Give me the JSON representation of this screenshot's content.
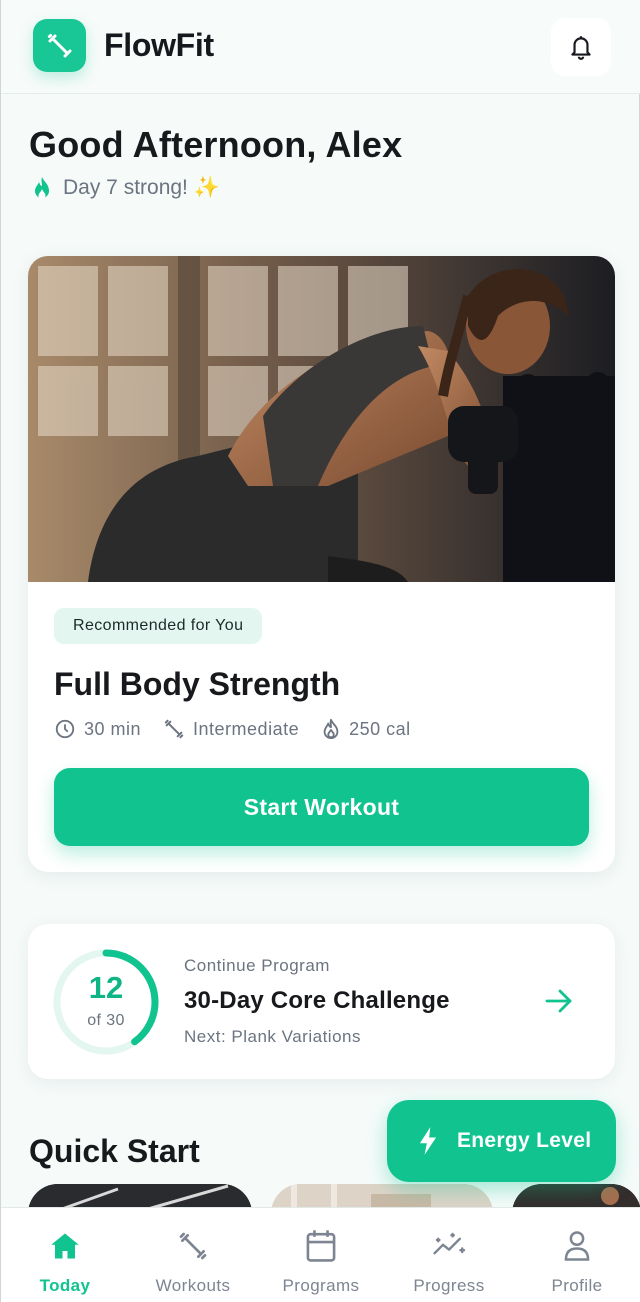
{
  "app": {
    "name": "FlowFit",
    "accent": "#10c38f",
    "logo_icon": "dumbbell-icon",
    "notification_icon": "bell-icon"
  },
  "greeting": {
    "title": "Good Afternoon, Alex",
    "streak_icon": "flame-icon",
    "streak_text": "Day 7 strong! ✨"
  },
  "recommended": {
    "badge": "Recommended for You",
    "title": "Full Body Strength",
    "meta": [
      {
        "icon": "clock-icon",
        "text": "30 min"
      },
      {
        "icon": "dumbbell-icon",
        "text": "Intermediate"
      },
      {
        "icon": "flame-icon",
        "text": "250 cal"
      }
    ],
    "button": "Start Workout"
  },
  "program": {
    "progress_current": "12",
    "progress_total_label": "of 30",
    "progress_fraction": 0.4,
    "label": "Continue Program",
    "title": "30-Day Core Challenge",
    "next": "Next: Plank Variations",
    "arrow_icon": "arrow-right-icon"
  },
  "quick_start": {
    "title": "Quick Start"
  },
  "fab": {
    "icon": "lightning-icon",
    "label": "Energy Level"
  },
  "nav": {
    "items": [
      {
        "label": "Today",
        "icon": "home-icon",
        "active": true
      },
      {
        "label": "Workouts",
        "icon": "dumbbell-icon",
        "active": false
      },
      {
        "label": "Programs",
        "icon": "calendar-icon",
        "active": false
      },
      {
        "label": "Progress",
        "icon": "progress-sparkle-icon",
        "active": false
      },
      {
        "label": "Profile",
        "icon": "person-icon",
        "active": false
      }
    ]
  }
}
